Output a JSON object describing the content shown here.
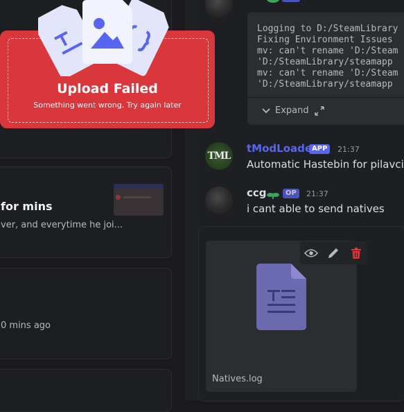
{
  "left_posts": [
    {
      "title": "for mins",
      "snippet": "ver, and everytime he joi..."
    },
    {
      "time": "0 mins ago"
    }
  ],
  "messages": {
    "top": {
      "code_lines": [
        "Logging to D:/SteamLibrary",
        "Fixing Environment Issues",
        "mv: can't rename 'D:/Steam",
        "'D:/SteamLibrary/steamapp",
        "mv: can't rename 'D:/Steam",
        "'D:/SteamLibrary/steamapp"
      ],
      "expand_label": "Expand"
    },
    "tmodloader": {
      "username": "tModLoader",
      "tag": "APP",
      "time": "21:37",
      "text": "Automatic Hastebin for pilavcitr",
      "avatar_text": "TML"
    },
    "ccg": {
      "username": "ccg",
      "tag": "OP",
      "time": "21:37",
      "text": "i cant able to send natives"
    }
  },
  "attachment": {
    "file_name": "Natives.log",
    "tools": [
      "eye-icon",
      "pencil-icon",
      "trash-icon"
    ]
  },
  "upload_error": {
    "title": "Upload Failed",
    "subtitle": "Something went wrong. Try again later"
  },
  "colors": {
    "error": "#da373c",
    "accent": "#5865f2",
    "tmod_name": "#5865f2",
    "op_name": "#57f287"
  }
}
